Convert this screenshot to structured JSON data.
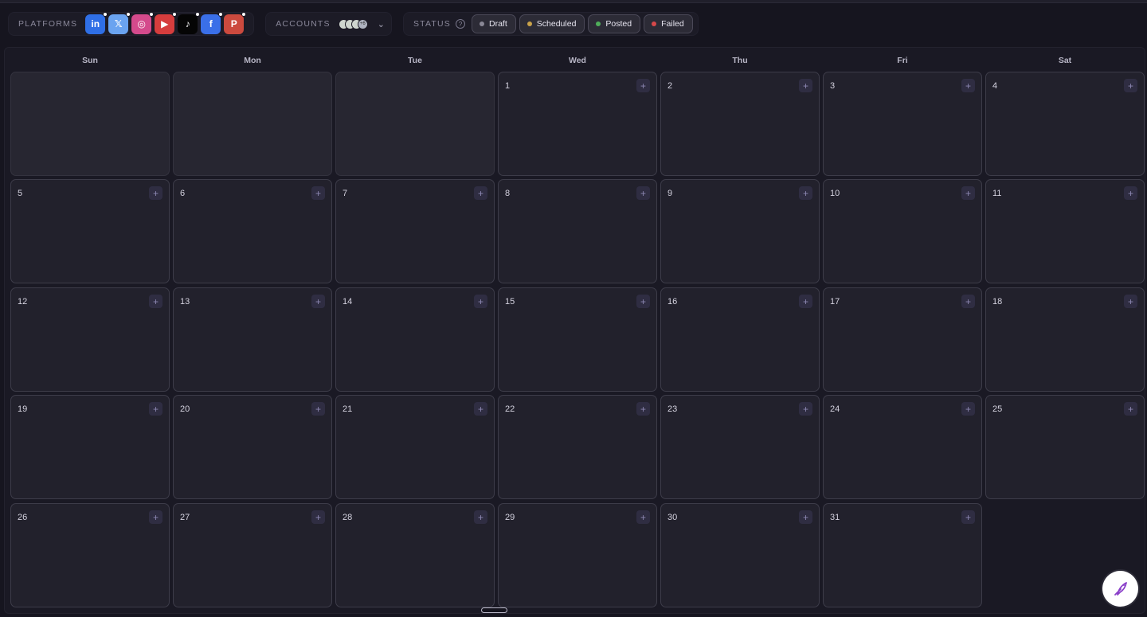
{
  "toolbar": {
    "platforms_label": "PLATFORMS",
    "accounts_label": "ACCOUNTS",
    "accounts_more": "+6",
    "status_label": "STATUS",
    "platforms": [
      {
        "name": "linkedin",
        "glyph": "in",
        "color": "#2f6fe6"
      },
      {
        "name": "x",
        "glyph": "𝕏",
        "color": "#6aa3f0"
      },
      {
        "name": "instagram",
        "glyph": "◎",
        "color": "#d44a8c"
      },
      {
        "name": "youtube",
        "glyph": "▶",
        "color": "#d63d3d"
      },
      {
        "name": "tiktok",
        "glyph": "♪",
        "color": "#050505"
      },
      {
        "name": "facebook",
        "glyph": "f",
        "color": "#3a6fe8"
      },
      {
        "name": "pinterest",
        "glyph": "P",
        "color": "#cc4a3e"
      }
    ],
    "statuses": [
      {
        "label": "Draft",
        "color": "#8a8896"
      },
      {
        "label": "Scheduled",
        "color": "#c9a24a"
      },
      {
        "label": "Posted",
        "color": "#4fae5a"
      },
      {
        "label": "Failed",
        "color": "#d6484a"
      }
    ]
  },
  "calendar": {
    "weekdays": [
      "Sun",
      "Mon",
      "Tue",
      "Wed",
      "Thu",
      "Fri",
      "Sat"
    ],
    "first_weekday_index": 3,
    "days_in_month": 31,
    "add_label": "+"
  }
}
